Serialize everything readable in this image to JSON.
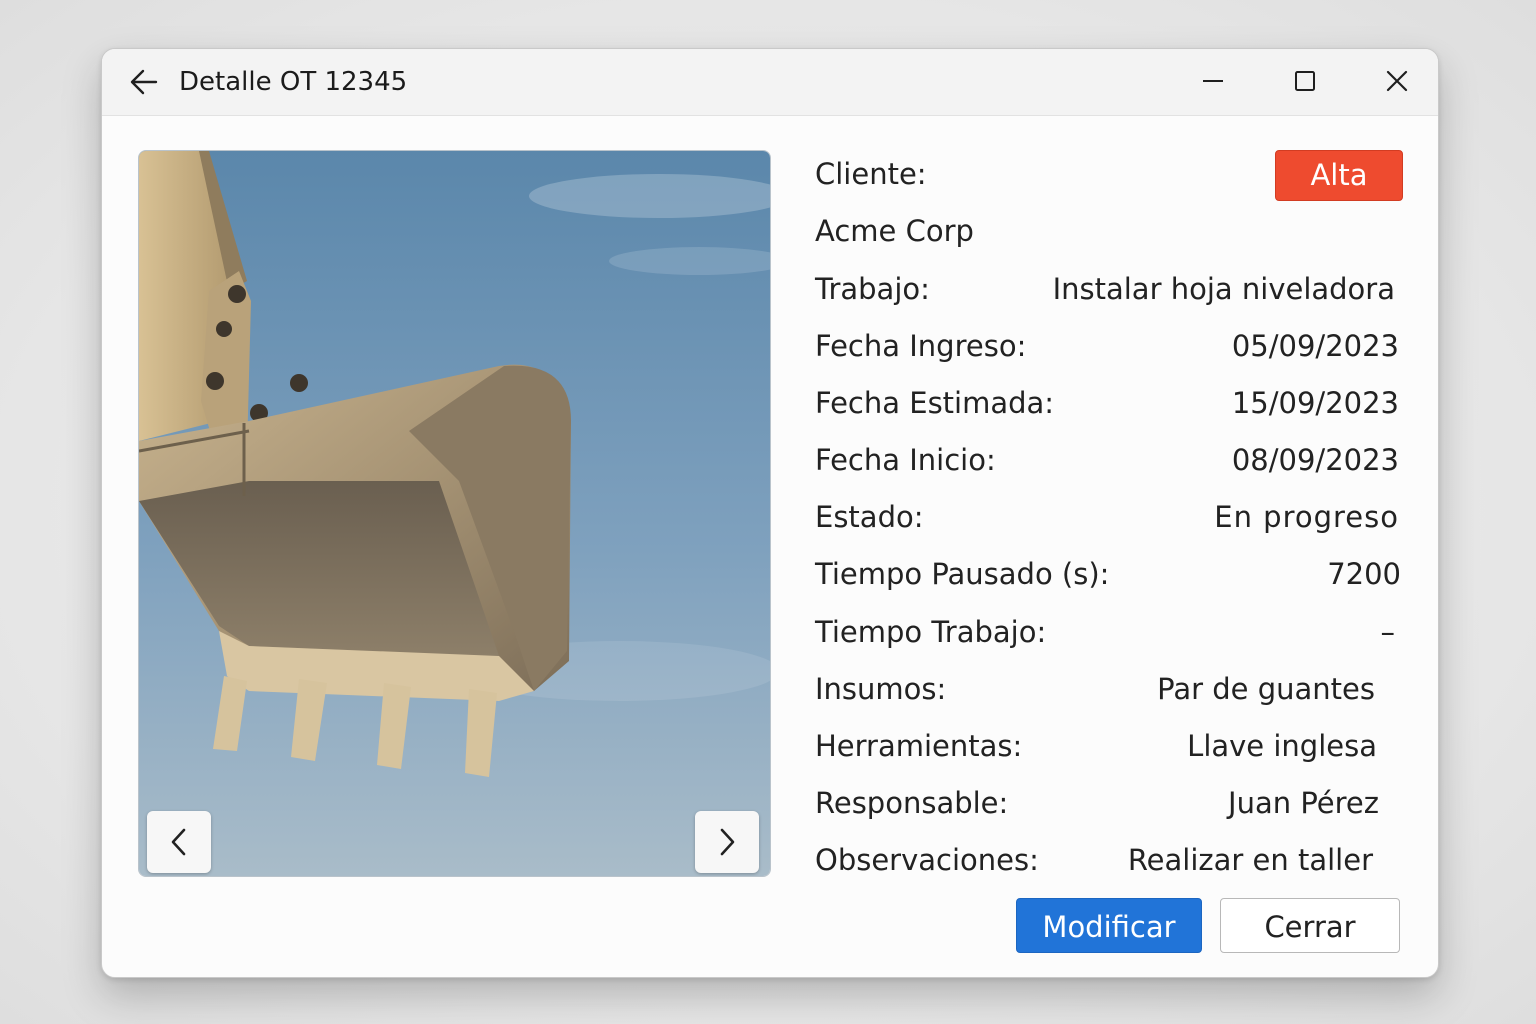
{
  "window": {
    "title": "Detalle OT 12345"
  },
  "photo": {
    "description_icon": "excavator-bucket-image",
    "prev_icon": "chevron-left-icon",
    "next_icon": "chevron-right-icon"
  },
  "priority": {
    "label": "Alta",
    "color": "#ee4b2f"
  },
  "details": {
    "cliente_label": "Cliente:",
    "cliente_value": "Acme Corp",
    "rows": [
      {
        "label": "Trabajo:",
        "value": "Instalar hoja niveladora"
      },
      {
        "label": "Fecha Ingreso:",
        "value": "05/09/2023"
      },
      {
        "label": "Fecha Estimada:",
        "value": "15/09/2023"
      },
      {
        "label": "Fecha Inicio:",
        "value": "08/09/2023"
      },
      {
        "label": "Estado:",
        "value": "En progreso"
      },
      {
        "label": "Tiempo Pausado (s):",
        "value": "7200"
      },
      {
        "label": "Tiempo Trabajo:",
        "value": "–"
      },
      {
        "label": "Insumos:",
        "value": "Par de guantes"
      },
      {
        "label": "Herramientas:",
        "value": "Llave inglesa"
      },
      {
        "label": "Responsable:",
        "value": "Juan Pérez"
      },
      {
        "label": "Observaciones:",
        "value": "Realizar en taller"
      }
    ]
  },
  "buttons": {
    "modify_label": "Modificar",
    "close_label": "Cerrar",
    "primary_color": "#2174d8"
  }
}
